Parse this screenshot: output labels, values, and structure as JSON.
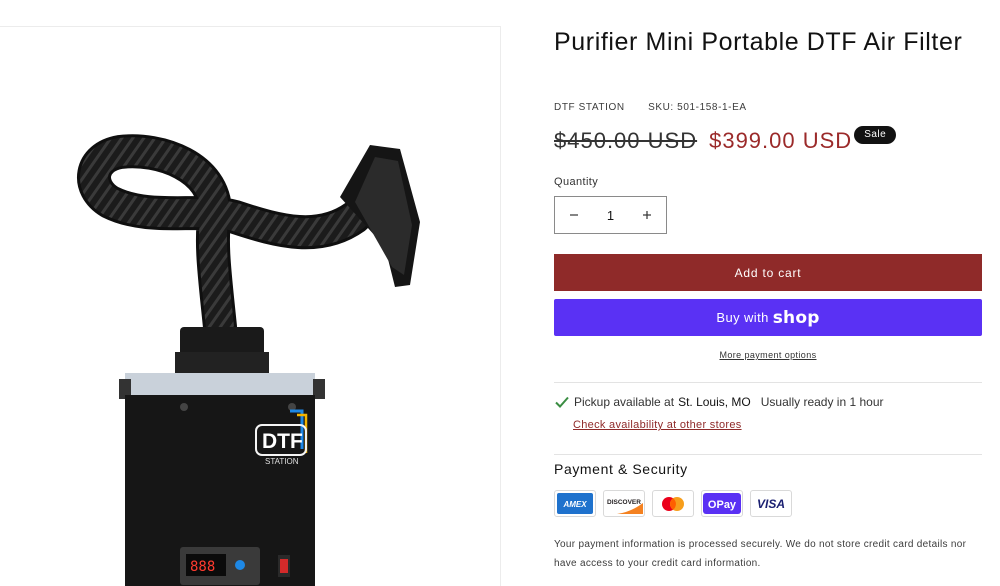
{
  "product": {
    "title": "Purifier Mini Portable DTF Air Filter",
    "vendor": "DTF STATION",
    "sku": "SKU: 501-158-1-EA",
    "image_label": "DTF",
    "image_sublabel": "STATION",
    "display_reading": "888"
  },
  "price": {
    "regular": "$450.00 USD",
    "sale": "$399.00 USD",
    "badge": "Sale"
  },
  "quantity": {
    "label": "Quantity",
    "value": "1",
    "decrease_icon": "minus-icon",
    "increase_icon": "plus-icon"
  },
  "buttons": {
    "add_to_cart": "Add to cart",
    "buy_with": "Buy with",
    "buy_brand": "shop",
    "more_options": "More payment options"
  },
  "pickup": {
    "text": "Pickup available at",
    "store": "St. Louis, MO",
    "ready": "Usually ready in 1 hour",
    "check_link": "Check availability at other stores",
    "icon": "check-icon"
  },
  "payment": {
    "heading": "Payment & Security",
    "methods": [
      "AMEX",
      "DISCOVER",
      "Mastercard",
      "OPay",
      "VISA"
    ],
    "note": "Your payment information is processed securely. We do not store credit card details nor have access to your credit card information."
  },
  "colors": {
    "accent": "#8f2a29",
    "sale_price": "#9b2a2a",
    "shop_pay": "#5a31f4",
    "amex": "#1f72cd",
    "discover_orange": "#f48120",
    "check_green": "#3a8d42"
  }
}
